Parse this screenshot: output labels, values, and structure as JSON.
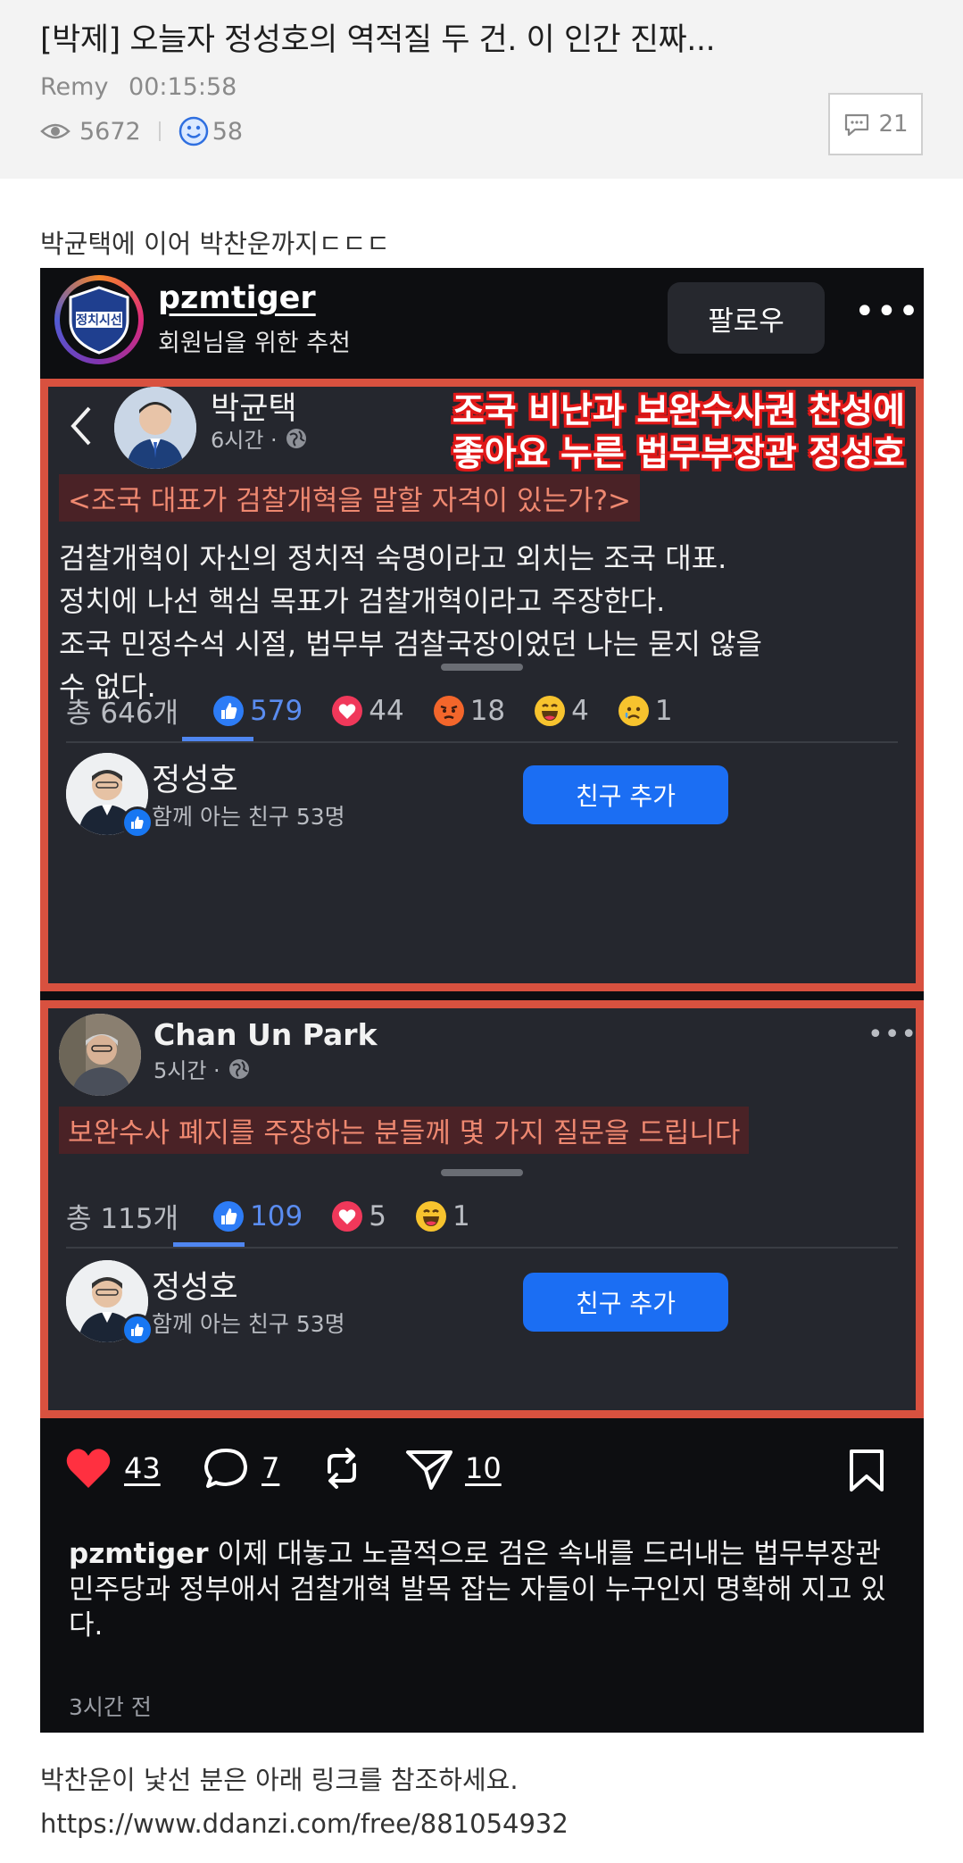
{
  "post": {
    "title": "[박제] 오늘자 정성호의 역적질 두 건. 이 인간 진짜...",
    "author": "Remy",
    "time": "00:15:58",
    "views": "5672",
    "likes": "58",
    "comments": "21"
  },
  "intro_text": "박균택에 이어 박찬운까지ㄷㄷㄷ",
  "instagram": {
    "username": "pzmtiger",
    "subtitle": "회원님을 위한 추천",
    "follow_label": "팔로우",
    "logo_text": "정치시선"
  },
  "card1": {
    "author": "박균택",
    "time": "6시간 ·",
    "overlay_line1": "조국 비난과 보완수사권 찬성에",
    "overlay_line2": "좋아요 누른 법무부장관 정성호",
    "headline": "<조국 대표가 검찰개혁을 말할 자격이 있는가?>",
    "body": [
      "검찰개혁이 자신의 정치적 숙명이라고 외치는 조국 대표.",
      "정치에 나선 핵심 목표가 검찰개혁이라고 주장한다.",
      "조국 민정수석 시절, 법무부 검찰국장이었던 나는 묻지 않을",
      "수 없다."
    ],
    "total": "총 646개",
    "reactions": {
      "like": "579",
      "love": "44",
      "angry": "18",
      "haha": "4",
      "sad": "1"
    },
    "friend_name": "정성호",
    "friend_sub": "함께 아는 친구 53명",
    "add_friend": "친구 추가"
  },
  "card2": {
    "author": "Chan Un Park",
    "time": "5시간 ·",
    "headline": "보완수사 폐지를 주장하는 분들께 몇 가지 질문을 드립니다",
    "total": "총 115개",
    "reactions": {
      "like": "109",
      "love": "5",
      "haha": "1"
    },
    "friend_name": "정성호",
    "friend_sub": "함께 아는 친구 53명",
    "add_friend": "친구 추가"
  },
  "actions": {
    "likes": "43",
    "comments": "7",
    "shares": "10"
  },
  "caption": {
    "user": "pzmtiger",
    "text1": " 이제 대놓고 노골적으로 검은 속내를 드러내는 법무부장관",
    "text2": "민주당과 정부애서 검찰개혁 발목 잡는 자들이 누구인지 명확해 지고 있다.",
    "time": "3시간 전"
  },
  "outro": {
    "line1": "박찬운이 낯선 분은 아래 링크를 참조하세요.",
    "link": "https://www.ddanzi.com/free/881054932"
  },
  "colors": {
    "accent_red": "#d8513f",
    "like_blue": "#1b6ef3",
    "heart_red": "#ff3040"
  }
}
